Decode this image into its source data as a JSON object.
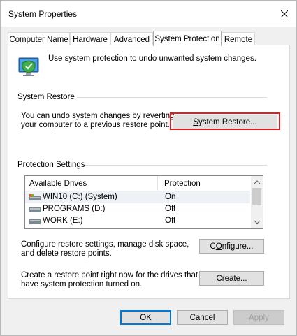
{
  "window": {
    "title": "System Properties"
  },
  "tabs": [
    "Computer Name",
    "Hardware",
    "Advanced",
    "System Protection",
    "Remote"
  ],
  "active_tab": "System Protection",
  "intro_text": "Use system protection to undo unwanted system changes.",
  "system_restore": {
    "group_title": "System Restore",
    "desc_line1": "You can undo system changes by reverting",
    "desc_line2": "your computer to a previous restore point.",
    "button_label": "System Restore...",
    "button_accel": "S",
    "button_rest": "ystem Restore..."
  },
  "protection": {
    "group_title": "Protection Settings",
    "columns": [
      "Available Drives",
      "Protection"
    ],
    "rows": [
      {
        "drive": "WIN10 (C:) (System)",
        "protection": "On",
        "icon": "system-drive-icon"
      },
      {
        "drive": "PROGRAMS (D:)",
        "protection": "Off",
        "icon": "drive-icon"
      },
      {
        "drive": "WORK (E:)",
        "protection": "Off",
        "icon": "drive-icon"
      }
    ],
    "configure_line1": "Configure restore settings, manage disk space,",
    "configure_line2": "and delete restore points.",
    "configure_accel": "O",
    "configure_pre": "C",
    "configure_post": "nfigure...",
    "create_line1": "Create a restore point right now for the drives that",
    "create_line2": "have system protection turned on.",
    "create_accel": "C",
    "create_post": "reate..."
  },
  "footer": {
    "ok": "OK",
    "cancel": "Cancel",
    "apply": "Apply",
    "apply_accel": "A",
    "apply_post": "pply"
  },
  "colors": {
    "highlight": "#e21d1d",
    "default_button_border": "#0078d7"
  }
}
